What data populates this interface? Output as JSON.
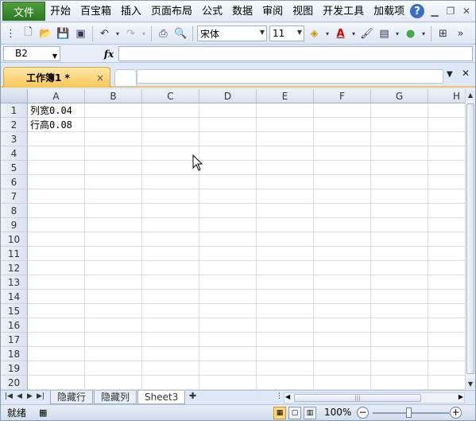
{
  "menu": {
    "file": "文件",
    "items": [
      "开始",
      "百宝箱",
      "插入",
      "页面布局",
      "公式",
      "数据",
      "审阅",
      "视图",
      "开发工具",
      "加载项"
    ]
  },
  "toolbar": {
    "font_name": "宋体",
    "font_size": "11"
  },
  "formula_bar": {
    "cell_ref": "B2",
    "fx": "fx",
    "content": ""
  },
  "workbook_tab": {
    "title": "工作簿1 *",
    "close": "×"
  },
  "grid": {
    "columns": [
      "A",
      "B",
      "C",
      "D",
      "E",
      "F",
      "G",
      "H"
    ],
    "rows": [
      "1",
      "2",
      "3",
      "4",
      "5",
      "6",
      "7",
      "8",
      "9",
      "10",
      "11",
      "12",
      "13",
      "14",
      "15",
      "16",
      "17",
      "18",
      "19",
      "20"
    ],
    "cells": {
      "A1": "列宽0.04",
      "A2": "行高0.08"
    }
  },
  "sheets": {
    "tabs": [
      "隐藏行",
      "隐藏列",
      "Sheet3"
    ],
    "active": "Sheet3"
  },
  "status": {
    "ready": "就绪",
    "zoom": "100%",
    "minus": "−",
    "plus": "+"
  },
  "colors": {
    "file_button": "#2d7a22",
    "workbook_tab": "#f8c657",
    "accent": "#3b6fc4"
  }
}
